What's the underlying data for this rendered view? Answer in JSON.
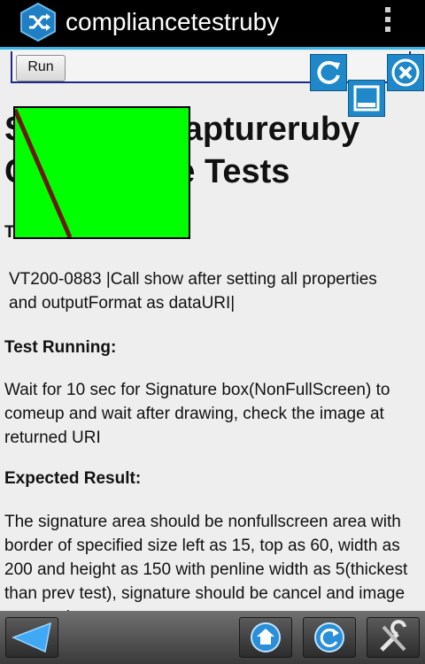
{
  "app": {
    "title": "compliancetestruby"
  },
  "controls": {
    "run_label": "Run"
  },
  "page": {
    "title": "SignatureCaptureruby Compliance Tests",
    "test_id_label": "Test Id:",
    "test_id": "VT200-0883 |Call show after setting all properties and outputFormat as dataURI|",
    "running_label": "Test Running:",
    "running_text": "Wait for 10 sec for Signature box(NonFullScreen) to comeup and wait after drawing, check the image at returned URI",
    "expected_label": "Expected Result:",
    "expected_text": "The signature area should be nonfullscreen area with border of specified size left as 15, top as 60, width as 200 and height as 150 with penline width as 5(thickest than prev test), signature should be cancel and image captured"
  },
  "signature": {
    "background_color": "#00ff00",
    "pen_color": "#6b1a00",
    "buttons": [
      "refresh-icon",
      "minimize-icon",
      "close-icon"
    ]
  },
  "toolbar": {
    "buttons": [
      "back-icon",
      "home-icon",
      "refresh-icon",
      "settings-icon"
    ]
  },
  "colors": {
    "accent": "#33b5e5",
    "action_button": "#1e88c8"
  }
}
